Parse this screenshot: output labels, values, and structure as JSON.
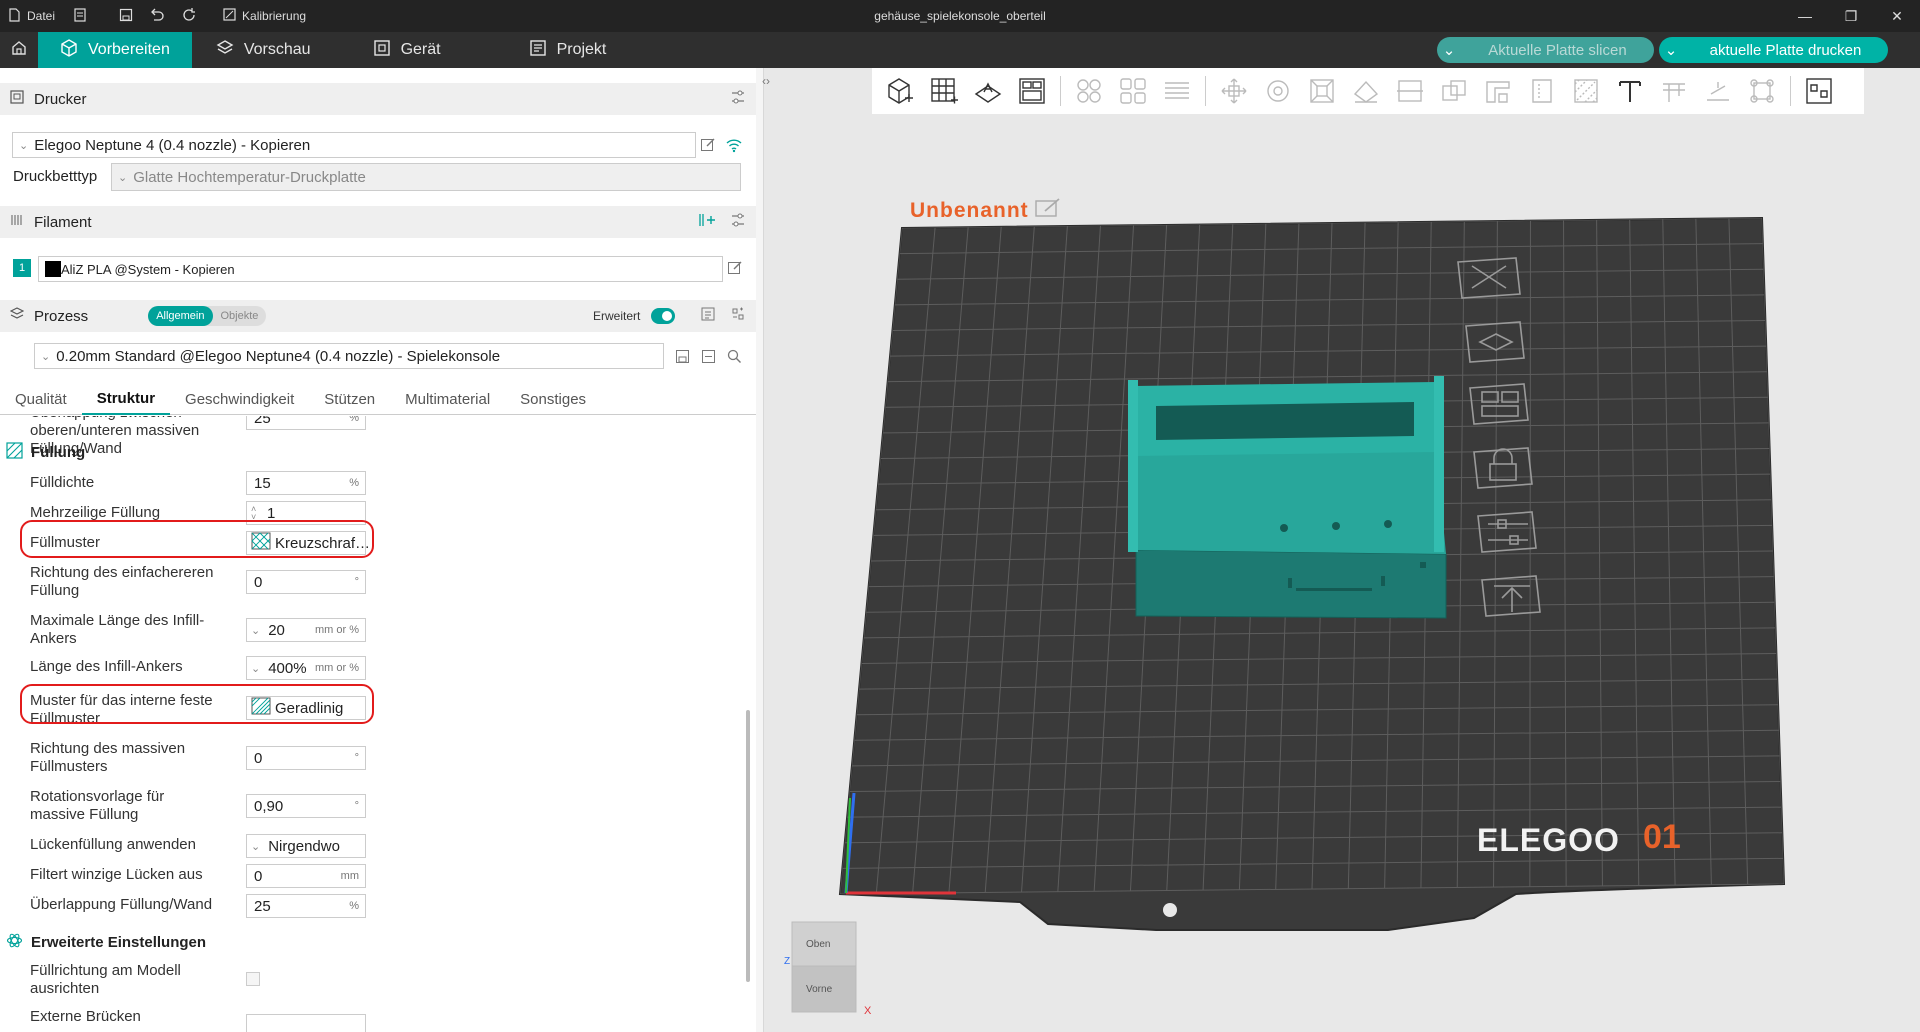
{
  "titlebar": {
    "file_label": "Datei",
    "calibration_label": "Kalibrierung",
    "window_title": "gehäuse_spielekonsole_oberteil"
  },
  "tabs": {
    "prepare": "Vorbereiten",
    "preview": "Vorschau",
    "device": "Gerät",
    "project": "Projekt"
  },
  "actions": {
    "slice_label": "Aktuelle Platte slicen",
    "print_label": "aktuelle Platte drucken"
  },
  "printer": {
    "section_title": "Drucker",
    "printer_name": "Elegoo Neptune 4 (0.4 nozzle) - Kopieren",
    "bed_type_label": "Druckbetttyp",
    "bed_type_value": "Glatte Hochtemperatur-Druckplatte"
  },
  "filament": {
    "section_title": "Filament",
    "slot_number": "1",
    "filament_name": "AliZ PLA @System - Kopieren"
  },
  "process": {
    "section_title": "Prozess",
    "mode_general": "Allgemein",
    "mode_objects": "Objekte",
    "advanced_label": "Erweitert",
    "advanced_on": true,
    "profile_name": "0.20mm Standard @Elegoo Neptune4 (0.4 nozzle) - Spielekonsole"
  },
  "subtabs": [
    "Qualität",
    "Struktur",
    "Geschwindigkeit",
    "Stützen",
    "Multimaterial",
    "Sonstiges"
  ],
  "active_subtab": "Struktur",
  "settings": {
    "partial_row_label": "Überlappung zwischen oberen/unteren massiven Füllung/Wand",
    "partial_row_value": "25",
    "partial_row_unit": "%",
    "infill_group": "Füllung",
    "rows": [
      {
        "label": "Fülldichte",
        "value": "15",
        "unit": "%"
      },
      {
        "label": "Mehrzeilige Füllung",
        "value": "1",
        "unit": ""
      },
      {
        "label": "Füllmuster",
        "value": "Kreuzschraf…",
        "unit": ""
      },
      {
        "label": "Richtung des einfachereren Füllung",
        "value": "0",
        "unit": "°"
      },
      {
        "label": "Maximale Länge des Infill-Ankers",
        "value": "20",
        "unit": "mm or %"
      },
      {
        "label": "Länge des Infill-Ankers",
        "value": "400%",
        "unit": "mm or %"
      },
      {
        "label": "Muster für das interne feste Füllmuster",
        "value": "Geradlinig",
        "unit": ""
      },
      {
        "label": "Richtung des massiven Füllmusters",
        "value": "0",
        "unit": "°"
      },
      {
        "label": "Rotationsvorlage für massive Füllung",
        "value": "0,90",
        "unit": "°"
      },
      {
        "label": "Lückenfüllung anwenden",
        "value": "Nirgendwo",
        "unit": ""
      },
      {
        "label": "Filtert winzige Lücken aus",
        "value": "0",
        "unit": "mm"
      },
      {
        "label": "Überlappung Füllung/Wand",
        "value": "25",
        "unit": "%"
      }
    ],
    "advanced_group": "Erweiterte Einstellungen",
    "align_infill_label": "Füllrichtung am Modell ausrichten",
    "external_bridges_label": "Externe Brücken"
  },
  "viewport": {
    "plate_name": "Unbenannt",
    "plate_number": "01",
    "bed_brand": "ELEGOO",
    "cube_top": "Oben",
    "cube_front": "Vorne",
    "axis_x": "X",
    "axis_z": "Z"
  },
  "colors": {
    "accent": "#00a29a",
    "model": "#1a8f86",
    "bed": "#3a3a3a",
    "plate_title": "#e8622a",
    "highlight": "#e21b1b"
  }
}
